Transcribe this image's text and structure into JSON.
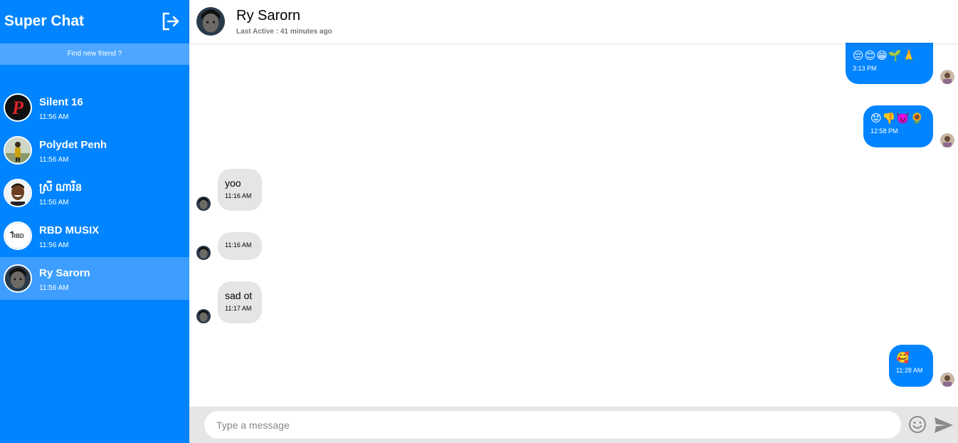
{
  "app": {
    "title": "Super Chat"
  },
  "sidebar": {
    "find_friend_label": "Find new friend ?",
    "friends": [
      {
        "name": "Silent 16",
        "time": "11:56 AM"
      },
      {
        "name": "Polydet Penh",
        "time": "11:56 AM"
      },
      {
        "name": "ស្រី ណារីន",
        "time": "11:56 AM"
      },
      {
        "name": "RBD MUSIX",
        "time": "11:56 AM"
      },
      {
        "name": "Ry Sarorn",
        "time": "11:56 AM"
      }
    ]
  },
  "chat": {
    "contact_name": "Ry Sarorn",
    "last_active": "Last Active : 41 minutes ago",
    "messages": [
      {
        "direction": "out",
        "text": "😔😊😁🌱🙏",
        "time": "3:13 PM"
      },
      {
        "direction": "out",
        "text": "😟👎👿🌻",
        "time": "12:58 PM"
      },
      {
        "direction": "in",
        "text": "yoo",
        "time": "11:16 AM"
      },
      {
        "direction": "in",
        "text": "",
        "time": "11:16 AM"
      },
      {
        "direction": "in",
        "text": "sad ot",
        "time": "11:17 AM"
      },
      {
        "direction": "out",
        "text": "🥰",
        "time": "11:28 AM"
      }
    ]
  },
  "composer": {
    "placeholder": "Type a message",
    "value": ""
  },
  "colors": {
    "accent": "#0084ff",
    "active_item": "#3d9eff",
    "find_bar": "#4da6ff",
    "incoming_bubble": "#e5e5e5"
  }
}
